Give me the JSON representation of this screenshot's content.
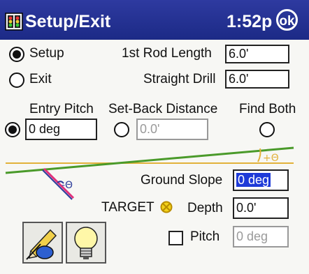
{
  "titlebar": {
    "title": "Setup/Exit",
    "time": "1:52p",
    "ok_label": "ok",
    "app_icon": "traffic-light-icon"
  },
  "mode": {
    "options": [
      {
        "label": "Setup",
        "selected": true
      },
      {
        "label": "Exit",
        "selected": false
      }
    ]
  },
  "rod": {
    "label": "1st Rod Length",
    "value": "6.0'"
  },
  "drill": {
    "label": "Straight Drill",
    "value": "6.0'"
  },
  "calc": {
    "entry_pitch": {
      "label": "Entry Pitch",
      "value": "0 deg",
      "selected": true
    },
    "setback": {
      "label": "Set-Back Distance",
      "value": "0.0'",
      "selected": false
    },
    "find_both": {
      "label": "Find Both",
      "selected": false
    }
  },
  "diagram": {
    "plus_label": "+Θ",
    "minus_label": "-Θ"
  },
  "ground_slope": {
    "label": "Ground Slope",
    "value": "0 deg"
  },
  "target": {
    "label": "TARGET",
    "icon": "target-icon"
  },
  "depth": {
    "label": "Depth",
    "value": "0.0'"
  },
  "pitch": {
    "label": "Pitch",
    "value": "0 deg",
    "checked": false
  },
  "tools": [
    {
      "icon": "pencil-icon"
    },
    {
      "icon": "lightbulb-icon"
    }
  ],
  "colors": {
    "titlebar": "#1c2a86",
    "ground_line": "#4a9a2a",
    "drill_line": "#e0307a",
    "selection": "#1e3ad8"
  }
}
